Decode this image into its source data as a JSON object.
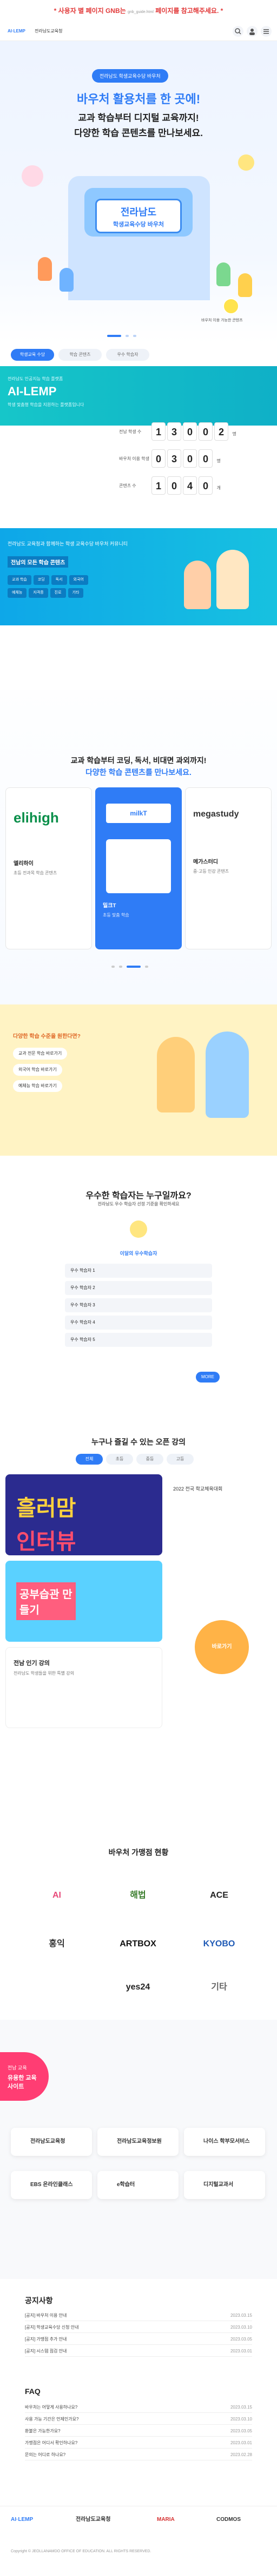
{
  "notice": {
    "text": "* 사용자 별 페이지 GNB는",
    "small": "gnb_guide.html",
    "link": "페이지를 참고해주세요. *"
  },
  "header": {
    "logos": [
      "AI·LEMP",
      "전라남도교육청"
    ],
    "icons": [
      "search-icon",
      "user-icon",
      "menu-icon"
    ]
  },
  "hero": {
    "badge": "전라남도 학생교육수당 바우처",
    "title_line1": "바우처 활용처를 한 곳에!",
    "title_line2": "교과 학습부터 디지털 교육까지!",
    "title_line3": "다양한 학습 콘텐츠를 만나보세요.",
    "board_line1": "전라남도",
    "board_line2": "학생교육수당 바우처",
    "side_note": "바우처 이용 가능한 콘텐츠"
  },
  "tabs": [
    "학생교육 수당",
    "학습 콘텐츠",
    "우수 학습자"
  ],
  "ailemp": {
    "small": "전라남도 인공지능 학습 플랫폼",
    "title": "AI-LEMP",
    "desc": "학생 맞춤형 학습을 지원하는 플랫폼입니다",
    "counters": [
      {
        "label": "전남 학생 수",
        "digits": [
          "1",
          "3",
          "0",
          "0",
          "2"
        ],
        "unit": "명"
      },
      {
        "label": "바우처 이용 학생",
        "digits": [
          "0",
          "3",
          "0",
          "0"
        ],
        "unit": "명"
      },
      {
        "label": "콘텐츠 수",
        "digits": [
          "1",
          "0",
          "4",
          "0"
        ],
        "unit": "개"
      }
    ]
  },
  "community": {
    "desc": "전라남도 교육청과 함께하는 학생 교육수당 바우처 커뮤니티",
    "highlight": "전남의 모든 학습 콘텐츠",
    "chips": [
      "교과 학습",
      "코딩",
      "독서",
      "외국어",
      "예체능",
      "자격증",
      "진로",
      "기타"
    ]
  },
  "lectures": {
    "title_line1": "교과 학습부터 코딩, 독서, 비대면 과외까지!",
    "title_line2": "다양한 학습 콘텐츠를 만나보세요.",
    "cards": [
      {
        "brand": "elihigh",
        "name": "엘리하이",
        "desc": "초등 전과목 학습 콘텐츠"
      },
      {
        "brand": "milkT",
        "name": "밀크T",
        "desc": "초등 맞춤 학습"
      },
      {
        "brand": "megastudy",
        "name": "메가스터디",
        "desc": "중·고등 인강 콘텐츠"
      }
    ]
  },
  "learn": {
    "badge": "다양한 학습 수준을 원한다면?",
    "buttons": [
      "교과 전문 학습 바로가기",
      "외국어 학습 바로가기",
      "예체능 학습 바로가기"
    ]
  },
  "ideal": {
    "title": "우수한 학습자는 누구일까요?",
    "desc": "전라남도 우수 학습자 선정 기준을 확인하세요",
    "badge": "이달의 우수학습자",
    "rows": [
      "우수 학습자 1",
      "우수 학습자 2",
      "우수 학습자 3",
      "우수 학습자 4",
      "우수 학습자 5"
    ],
    "more": "MORE"
  },
  "popular": {
    "title": "누구나 즐길 수 있는 오픈 강의",
    "filters": [
      "전체",
      "초등",
      "중등",
      "고등"
    ],
    "card1_text1": "흘러맘",
    "card1_text2": "인터뷰",
    "card2_text": "공부습관 만들기",
    "card3_title": "전남 인기 강의",
    "card3_desc": "전라남도 학생들을 위한 특별 강의",
    "side_title": "2022 전국 학교체육대회",
    "side_btn": "바로가기"
  },
  "partners": {
    "title": "바우처 가맹점 현황",
    "items": [
      "AI",
      "해법",
      "ACE",
      "홍익",
      "ARTBOX",
      "KYOBO",
      "yes24",
      "기타"
    ]
  },
  "sites": {
    "badge": "전남 교육",
    "title": "유용한 교육 사이트",
    "items": [
      "전라남도교육청",
      "전라남도교육정보원",
      "나이스 학부모서비스",
      "EBS 온라인클래스",
      "e학습터",
      "디지털교과서"
    ]
  },
  "board": {
    "notice_title": "공지사항",
    "notices": [
      {
        "text": "[공지] 바우처 이용 안내",
        "date": "2023.03.15"
      },
      {
        "text": "[공지] 학생교육수당 신청 안내",
        "date": "2023.03.10"
      },
      {
        "text": "[공지] 가맹점 추가 안내",
        "date": "2023.03.05"
      },
      {
        "text": "[공지] 시스템 점검 안내",
        "date": "2023.03.01"
      }
    ],
    "faq_title": "FAQ",
    "faqs": [
      {
        "text": "바우처는 어떻게 사용하나요?",
        "date": "2023.03.15"
      },
      {
        "text": "사용 가능 기간은 언제인가요?",
        "date": "2023.03.10"
      },
      {
        "text": "환불은 가능한가요?",
        "date": "2023.03.05"
      },
      {
        "text": "가맹점은 어디서 확인하나요?",
        "date": "2023.03.01"
      },
      {
        "text": "문의는 어디로 하나요?",
        "date": "2023.02.28"
      }
    ]
  },
  "footer": {
    "logos": [
      "AI·LEMP",
      "전라남도교육청",
      "MARIA",
      "CODMOS"
    ],
    "copyright": "Copyright © JEOLLANAMDO OFFICE OF EDUCATION. ALL RIGHTS RESERVED."
  },
  "colors": {
    "primary": "#2f7cf6",
    "teal": "#16c6c9",
    "yellow": "#fff3c4"
  }
}
